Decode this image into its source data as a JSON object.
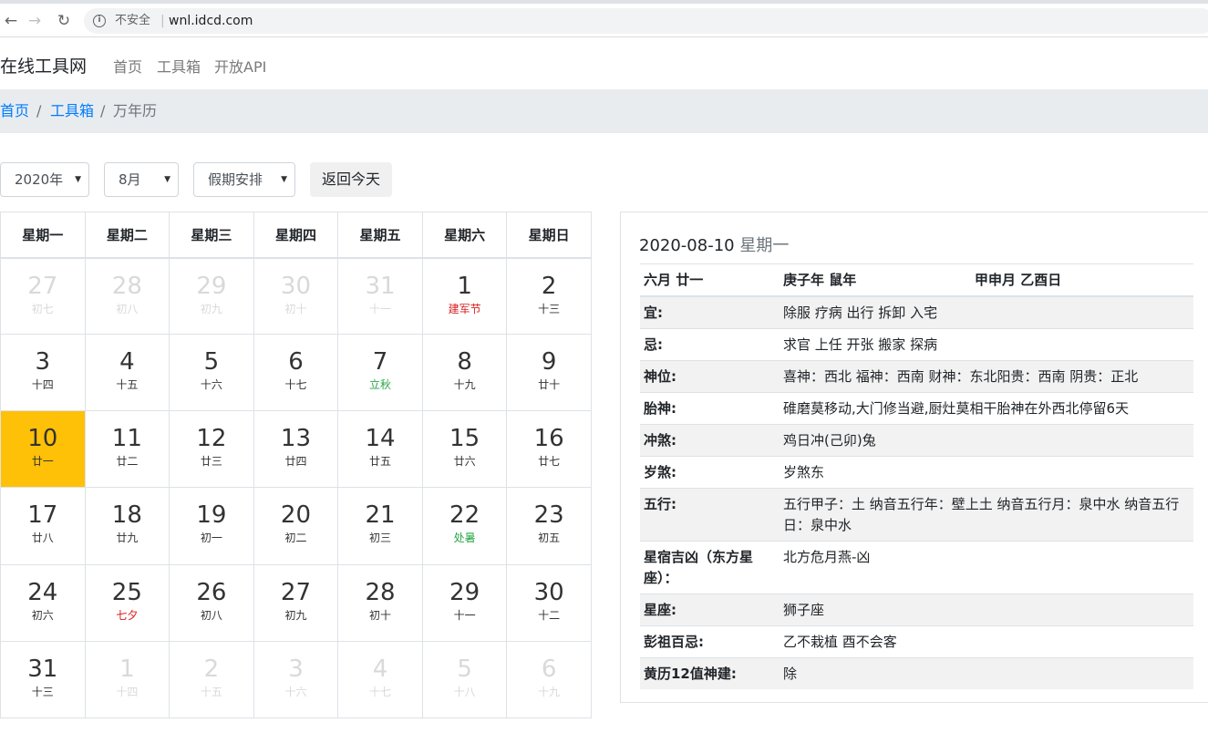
{
  "browser": {
    "back_icon": "arrow-left-icon",
    "forward_icon": "arrow-right-icon",
    "reload_icon": "reload-icon",
    "insecure_label": "不安全",
    "url": "wnl.idcd.com"
  },
  "navbar": {
    "brand": "在线工具网",
    "links": [
      "首页",
      "工具箱",
      "开放API"
    ]
  },
  "breadcrumb": {
    "home": "首页",
    "tools": "工具箱",
    "current": "万年历",
    "divider": "/"
  },
  "controls": {
    "year": "2020年",
    "month": "8月",
    "holiday": "假期安排",
    "today_button": "返回今天"
  },
  "calendar": {
    "weekdays": [
      "星期一",
      "星期二",
      "星期三",
      "星期四",
      "星期五",
      "星期六",
      "星期日"
    ],
    "weeks": [
      [
        {
          "d": "27",
          "l": "初七",
          "o": true
        },
        {
          "d": "28",
          "l": "初八",
          "o": true
        },
        {
          "d": "29",
          "l": "初九",
          "o": true
        },
        {
          "d": "30",
          "l": "初十",
          "o": true
        },
        {
          "d": "31",
          "l": "十一",
          "o": true
        },
        {
          "d": "1",
          "l": "建军节",
          "c": "red"
        },
        {
          "d": "2",
          "l": "十三"
        }
      ],
      [
        {
          "d": "3",
          "l": "十四"
        },
        {
          "d": "4",
          "l": "十五"
        },
        {
          "d": "5",
          "l": "十六"
        },
        {
          "d": "6",
          "l": "十七"
        },
        {
          "d": "7",
          "l": "立秋",
          "c": "green"
        },
        {
          "d": "8",
          "l": "十九"
        },
        {
          "d": "9",
          "l": "廿十"
        }
      ],
      [
        {
          "d": "10",
          "l": "廿一",
          "t": true
        },
        {
          "d": "11",
          "l": "廿二"
        },
        {
          "d": "12",
          "l": "廿三"
        },
        {
          "d": "13",
          "l": "廿四"
        },
        {
          "d": "14",
          "l": "廿五"
        },
        {
          "d": "15",
          "l": "廿六"
        },
        {
          "d": "16",
          "l": "廿七"
        }
      ],
      [
        {
          "d": "17",
          "l": "廿八"
        },
        {
          "d": "18",
          "l": "廿九"
        },
        {
          "d": "19",
          "l": "初一"
        },
        {
          "d": "20",
          "l": "初二"
        },
        {
          "d": "21",
          "l": "初三"
        },
        {
          "d": "22",
          "l": "处暑",
          "c": "green"
        },
        {
          "d": "23",
          "l": "初五"
        }
      ],
      [
        {
          "d": "24",
          "l": "初六"
        },
        {
          "d": "25",
          "l": "七夕",
          "c": "red"
        },
        {
          "d": "26",
          "l": "初八"
        },
        {
          "d": "27",
          "l": "初九"
        },
        {
          "d": "28",
          "l": "初十"
        },
        {
          "d": "29",
          "l": "十一"
        },
        {
          "d": "30",
          "l": "十二"
        }
      ],
      [
        {
          "d": "31",
          "l": "十三"
        },
        {
          "d": "1",
          "l": "十四",
          "o": true
        },
        {
          "d": "2",
          "l": "十五",
          "o": true
        },
        {
          "d": "3",
          "l": "十六",
          "o": true
        },
        {
          "d": "4",
          "l": "十七",
          "o": true
        },
        {
          "d": "5",
          "l": "十八",
          "o": true
        },
        {
          "d": "6",
          "l": "十九",
          "o": true
        }
      ]
    ]
  },
  "detail": {
    "date": "2020-08-10",
    "weekday": "星期一",
    "lunar": "六月 廿一",
    "ganzhi_year": "庚子年 鼠年",
    "ganzhi_month_day": "甲申月 乙酉日",
    "rows": [
      {
        "k": "宜:",
        "v": "除服 疗病 出行 拆卸 入宅"
      },
      {
        "k": "忌:",
        "v": "求官 上任 开张 搬家 探病"
      },
      {
        "k": "神位:",
        "v": "喜神：西北 福神：西南 财神：东北阳贵：西南 阴贵：正北"
      },
      {
        "k": "胎神:",
        "v": "碓磨莫移动,大门修当避,厨灶莫相干胎神在外西北停留6天"
      },
      {
        "k": "冲煞:",
        "v": "鸡日冲(己卯)兔"
      },
      {
        "k": "岁煞:",
        "v": "岁煞东"
      },
      {
        "k": "五行:",
        "v": "五行甲子：土 纳音五行年：壁上土 纳音五行月：泉中水 纳音五行日：泉中水"
      },
      {
        "k": "星宿吉凶（东方星座）：",
        "v": "北方危月燕-凶"
      },
      {
        "k": "星座:",
        "v": "狮子座"
      },
      {
        "k": "彭祖百忌:",
        "v": "乙不栽植 酉不会客"
      },
      {
        "k": "黄历12值神建:",
        "v": "除"
      }
    ]
  }
}
